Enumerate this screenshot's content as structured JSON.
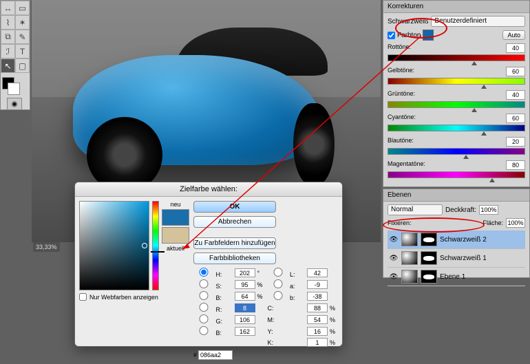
{
  "panels": {
    "korrekturen_title": "Korrekturen",
    "ebenen_title": "Ebenen"
  },
  "bw": {
    "label": "Schwarzweiß",
    "preset": "Benutzerdefiniert",
    "farbton_label": "Farbton",
    "auto": "Auto",
    "sliders": [
      {
        "label": "Rottöne:",
        "value": "40",
        "grad": "grad-red",
        "pos": 61
      },
      {
        "label": "Gelbtöne:",
        "value": "60",
        "grad": "grad-yellow",
        "pos": 68
      },
      {
        "label": "Grüntöne:",
        "value": "40",
        "grad": "grad-green",
        "pos": 61
      },
      {
        "label": "Cyantöne:",
        "value": "60",
        "grad": "grad-cyan",
        "pos": 68
      },
      {
        "label": "Blautöne:",
        "value": "20",
        "grad": "grad-blue",
        "pos": 55
      },
      {
        "label": "Magentatöne:",
        "value": "80",
        "grad": "grad-magenta",
        "pos": 74
      }
    ]
  },
  "layers": {
    "blend": "Normal",
    "deckkraft_label": "Deckkraft:",
    "deckkraft": "100%",
    "fixieren_label": "Fixieren:",
    "flache_label": "Fläche:",
    "flache": "100%",
    "items": [
      {
        "name": "Schwarzweiß 2",
        "sel": true
      },
      {
        "name": "Schwarzweiß 1",
        "sel": false
      },
      {
        "name": "Ebene 1",
        "sel": false
      }
    ]
  },
  "status": {
    "zoom": "33,33%"
  },
  "dialog": {
    "title": "Zielfarbe wählen:",
    "ok": "OK",
    "cancel": "Abbrechen",
    "add_swatch": "Zu Farbfeldern hinzufügen",
    "libs": "Farbbibliotheken",
    "neu": "neu",
    "aktuell": "aktuell",
    "webonly": "Nur Webfarben anzeigen",
    "hex": "086aa2",
    "H": "202",
    "Hd": "°",
    "S": "95",
    "Sp": "%",
    "Bv": "64",
    "Bp": "%",
    "R": "8",
    "G": "106",
    "Bb": "162",
    "L": "42",
    "a": "-9",
    "b": "-38",
    "C": "88",
    "Cp": "%",
    "M": "54",
    "Mp": "%",
    "Y": "16",
    "Yp": "%",
    "K": "1",
    "Kp": "%"
  },
  "icons": {
    "camera": "◉"
  }
}
